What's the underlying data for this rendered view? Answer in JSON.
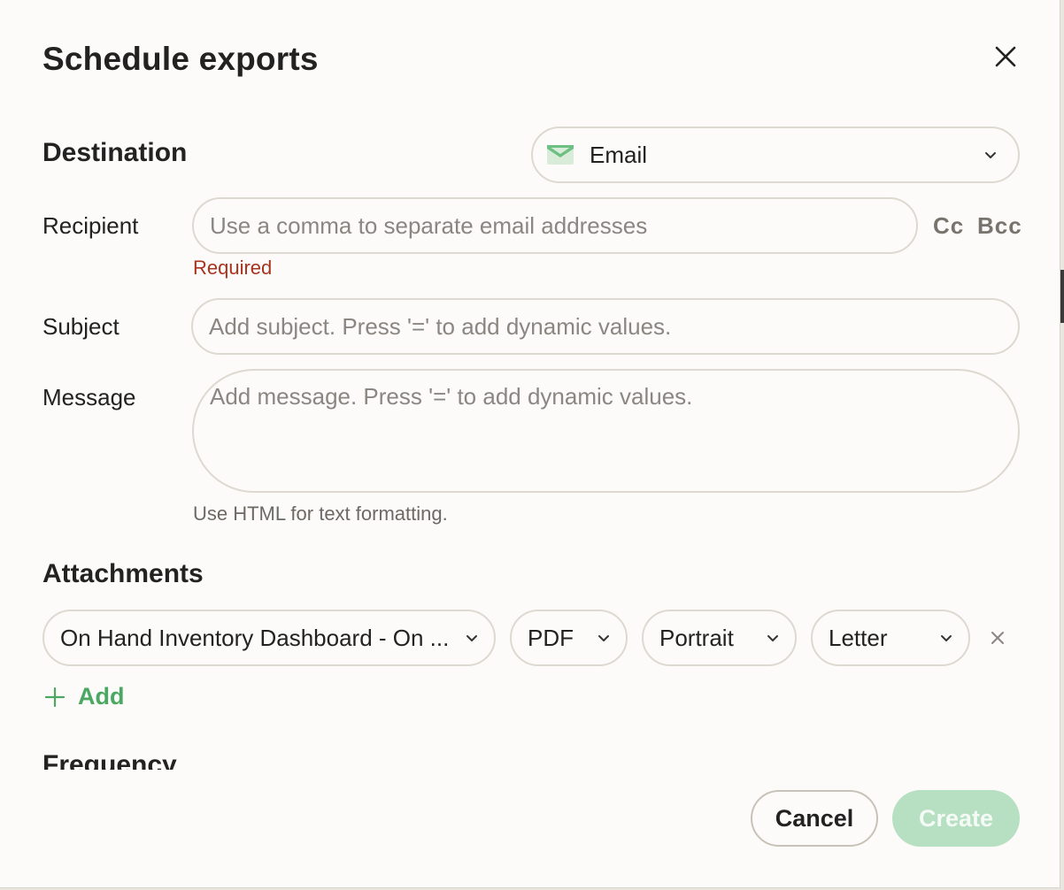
{
  "dialog": {
    "title": "Schedule exports"
  },
  "destination": {
    "heading": "Destination",
    "selected": "Email",
    "icon": "email-envelope-icon",
    "accent": "#6dbf82"
  },
  "recipient": {
    "label": "Recipient",
    "placeholder": "Use a comma to separate email addresses",
    "value": "",
    "cc_label": "Cc",
    "bcc_label": "Bcc",
    "error": "Required"
  },
  "subject": {
    "label": "Subject",
    "placeholder": "Add subject. Press '=' to add dynamic values.",
    "value": ""
  },
  "message": {
    "label": "Message",
    "placeholder": "Add message. Press '=' to add dynamic values.",
    "value": "",
    "helper": "Use HTML for text formatting."
  },
  "attachments": {
    "heading": "Attachments",
    "items": [
      {
        "dashboard": "On Hand Inventory Dashboard - On ...",
        "format": "PDF",
        "orientation": "Portrait",
        "paper_size": "Letter"
      }
    ],
    "add_label": "Add"
  },
  "frequency": {
    "heading": "Frequency"
  },
  "footer": {
    "cancel_label": "Cancel",
    "create_label": "Create"
  },
  "colors": {
    "error": "#a8321e",
    "primary_disabled": "#b7dfc1",
    "link_green": "#4aa862"
  }
}
